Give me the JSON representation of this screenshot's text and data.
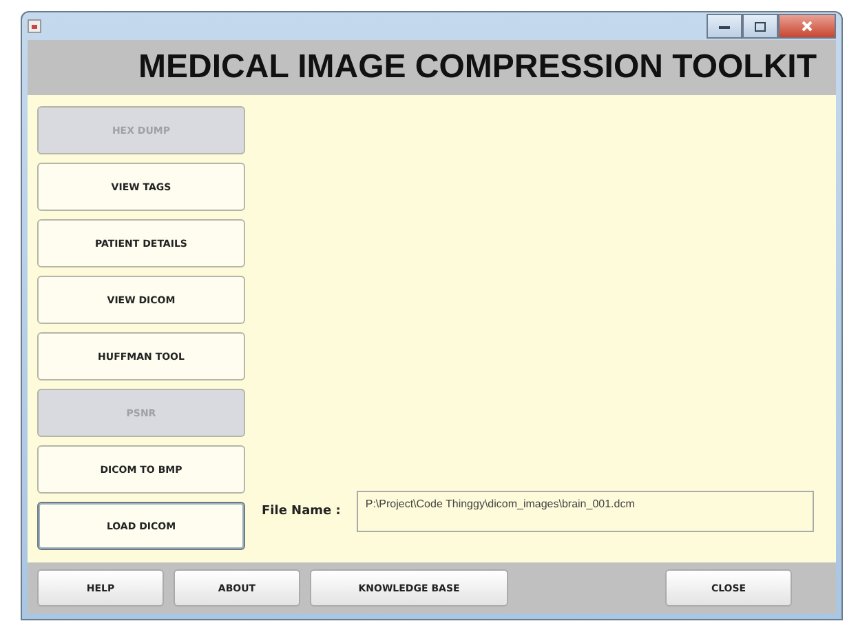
{
  "window": {
    "title": "MEDICAL IMAGE COMPRESSION TOOLKIT"
  },
  "sidebar": [
    {
      "label": "HEX DUMP",
      "disabled": true,
      "focused": false
    },
    {
      "label": "VIEW TAGS",
      "disabled": false,
      "focused": false
    },
    {
      "label": "PATIENT DETAILS",
      "disabled": false,
      "focused": false
    },
    {
      "label": "VIEW DICOM",
      "disabled": false,
      "focused": false
    },
    {
      "label": "HUFFMAN TOOL",
      "disabled": false,
      "focused": false
    },
    {
      "label": "PSNR",
      "disabled": true,
      "focused": false
    },
    {
      "label": "DICOM TO BMP",
      "disabled": false,
      "focused": false
    },
    {
      "label": "LOAD DICOM",
      "disabled": false,
      "focused": true
    }
  ],
  "file_name": {
    "label": "File Name :",
    "value": "P:\\Project\\Code Thinggy\\dicom_images\\brain_001.dcm"
  },
  "footer_buttons": [
    {
      "label": "HELP"
    },
    {
      "label": "ABOUT"
    },
    {
      "label": "KNOWLEDGE BASE"
    },
    {
      "label": "CLOSE"
    }
  ]
}
